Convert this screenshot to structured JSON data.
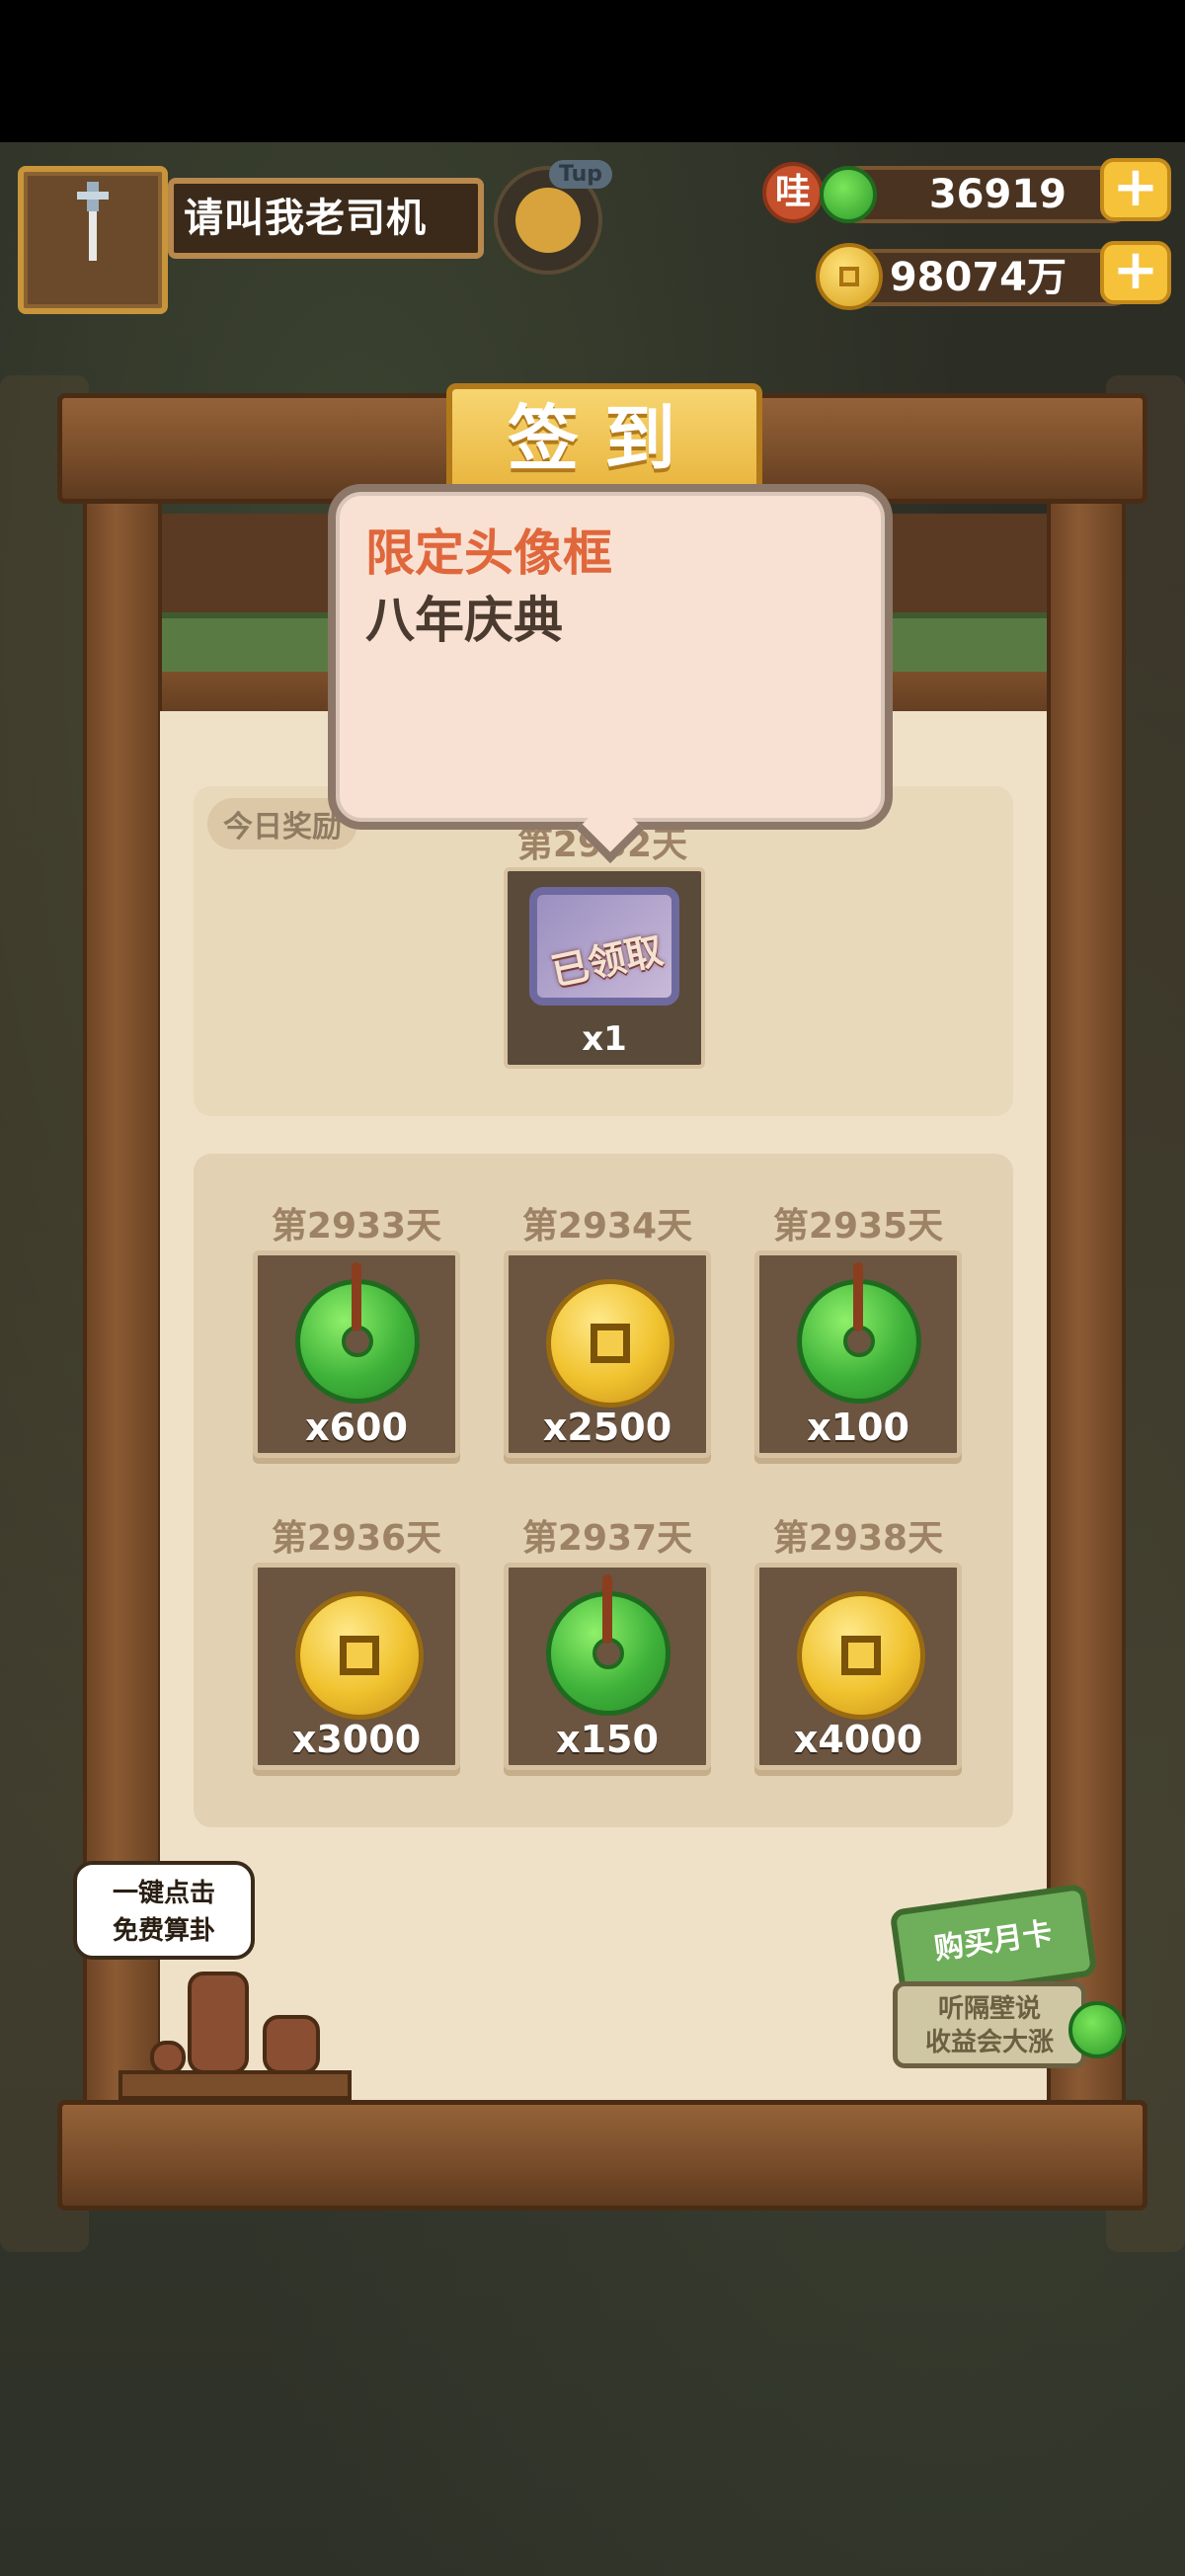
{
  "player": {
    "name": "请叫我老司机",
    "tup_badge": "Tup"
  },
  "currencies": {
    "jade": {
      "badge": "哇",
      "value": "36919",
      "add": "+"
    },
    "coins": {
      "value": "98074万",
      "add": "+"
    }
  },
  "signin": {
    "title": "签到",
    "today_label": "今日奖励",
    "today_day": "第2932天",
    "today_reward": {
      "status": "已领取",
      "qty": "x1"
    },
    "tooltip": {
      "title": "限定头像框",
      "subtitle": "八年庆典"
    },
    "days": [
      {
        "day": "第2933天",
        "type": "jade",
        "qty": "x600"
      },
      {
        "day": "第2934天",
        "type": "coin",
        "qty": "x2500"
      },
      {
        "day": "第2935天",
        "type": "jade",
        "qty": "x100"
      },
      {
        "day": "第2936天",
        "type": "coin",
        "qty": "x3000"
      },
      {
        "day": "第2937天",
        "type": "jade",
        "qty": "x150"
      },
      {
        "day": "第2938天",
        "type": "coin",
        "qty": "x4000"
      }
    ]
  },
  "fortune_bubble": {
    "line1": "一键点击",
    "line2": "免费算卦"
  },
  "monthly_card": {
    "label": "购买月卡",
    "line1": "听隔壁说",
    "line2": "收益会大涨"
  },
  "colors": {
    "accent_gold": "#f5c23a",
    "wood": "#7a4e2b",
    "tooltip_title": "#e0673c"
  }
}
